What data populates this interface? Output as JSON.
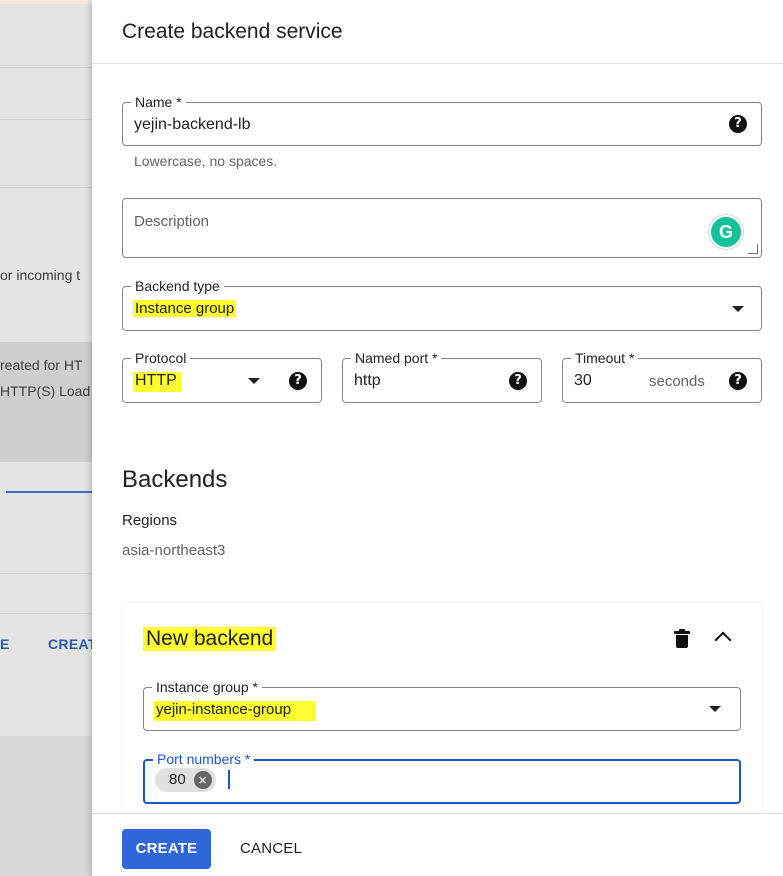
{
  "background": {
    "text_incoming": "or incoming t",
    "text_created": "reated for HT",
    "text_loadbalancing": "HTTP(S) Load",
    "link_e": "E",
    "link_create": "CREAT"
  },
  "panel": {
    "title": "Create backend service",
    "name": {
      "label": "Name *",
      "value": "yejin-backend-lb",
      "hint": "Lowercase, no spaces."
    },
    "description": {
      "placeholder": "Description"
    },
    "backend_type": {
      "label": "Backend type",
      "value": "Instance group"
    },
    "protocol": {
      "label": "Protocol",
      "value": "HTTP"
    },
    "named_port": {
      "label": "Named port *",
      "value": "http"
    },
    "timeout": {
      "label": "Timeout *",
      "value": "30",
      "unit": "seconds"
    },
    "backends": {
      "title": "Backends",
      "regions_label": "Regions",
      "regions_value": "asia-northeast3",
      "new_backend": {
        "title": "New backend",
        "instance_group": {
          "label": "Instance group *",
          "value": "yejin-instance-group"
        },
        "port_numbers": {
          "label": "Port numbers *",
          "chips": [
            "80"
          ]
        }
      }
    },
    "footer": {
      "create_label": "CREATE",
      "cancel_label": "CANCEL"
    }
  },
  "icons": {
    "help": "help-icon",
    "dropdown": "dropdown-icon",
    "delete": "trash-icon",
    "collapse": "chevron-up-icon",
    "chip_remove": "close-circle-icon",
    "grammarly": "grammarly-icon"
  },
  "colors": {
    "highlight": "#fdfd2f",
    "primary": "#2f66d8",
    "focus": "#1a56c9"
  }
}
